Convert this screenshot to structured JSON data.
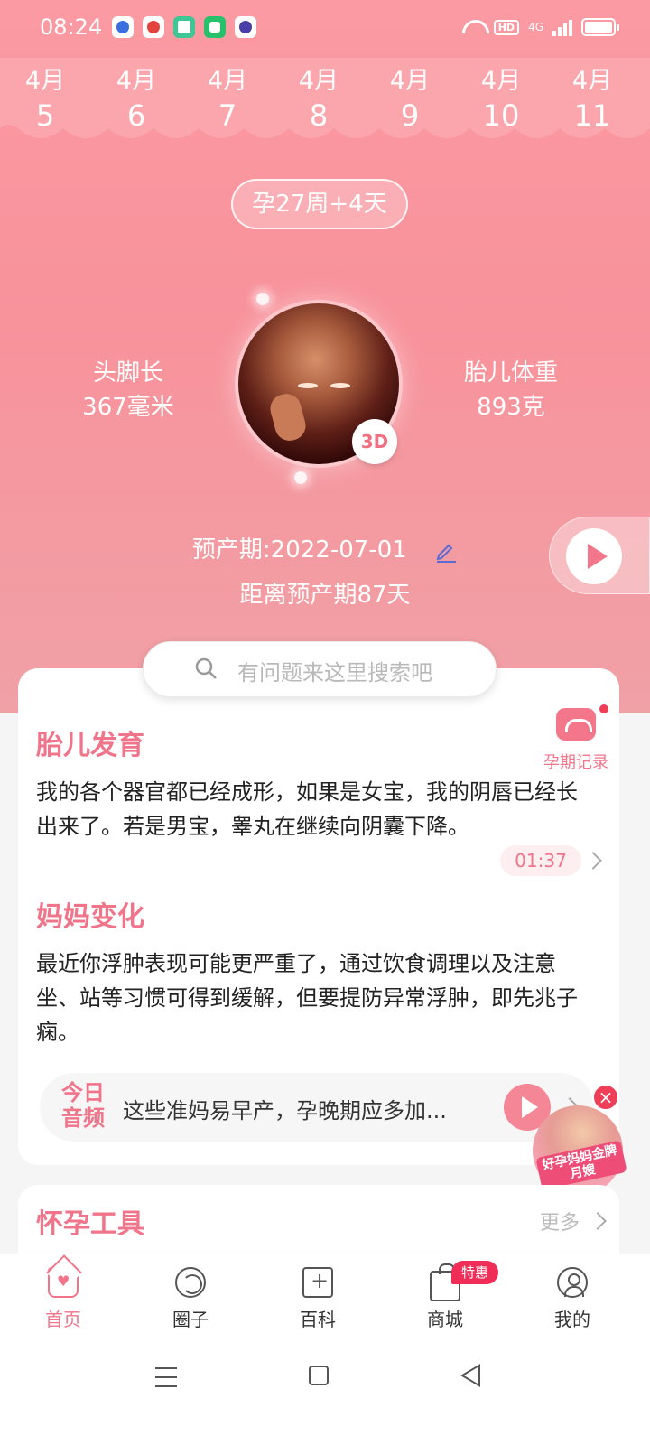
{
  "status_bar": {
    "time": "08:24",
    "apps": [
      "baidu-icon",
      "map-icon",
      "reader-icon",
      "app-icon",
      "browser-icon"
    ],
    "network": "4G",
    "hd": "HD"
  },
  "dates": [
    {
      "month": "4月",
      "day": "5",
      "selected": true
    },
    {
      "month": "4月",
      "day": "6"
    },
    {
      "month": "4月",
      "day": "7"
    },
    {
      "month": "4月",
      "day": "8"
    },
    {
      "month": "4月",
      "day": "9"
    },
    {
      "month": "4月",
      "day": "10"
    },
    {
      "month": "4月",
      "day": "11"
    }
  ],
  "pregnancy": {
    "week_label": "孕27周+4天",
    "length_label": "头脚长",
    "length_value": "367毫米",
    "weight_label": "胎儿体重",
    "weight_value": "893克",
    "badge_3d": "3D",
    "due_date": "预产期:2022-07-01",
    "countdown": "距离预产期87天"
  },
  "search": {
    "placeholder": "有问题来这里搜索吧"
  },
  "record": {
    "label": "孕期记录"
  },
  "sections": {
    "fetal_title": "胎儿发育",
    "fetal_text": "我的各个器官都已经成形，如果是女宝，我的阴唇已经长出来了。若是男宝，睾丸在继续向阴囊下降。",
    "fetal_duration": "01:37",
    "mom_title": "妈妈变化",
    "mom_text": "最近你浮肿表现可能更严重了，通过饮食调理以及注意坐、站等习惯可得到缓解，但要提防异常浮肿，即先兆子痫。",
    "tools_title": "怀孕工具",
    "tools_more": "更多"
  },
  "daily_audio": {
    "logo_line1": "今日",
    "logo_line2": "音频",
    "text": "这些准妈易早产，孕晚期应多加..."
  },
  "float_ad": {
    "text": "好孕妈妈金牌月嫂",
    "close": "×"
  },
  "bottom_nav": [
    {
      "label": "首页",
      "icon": "home-icon",
      "active": true
    },
    {
      "label": "圈子",
      "icon": "circle-icon"
    },
    {
      "label": "百科",
      "icon": "encyclopedia-icon"
    },
    {
      "label": "商城",
      "icon": "shop-icon"
    },
    {
      "label": "我的",
      "icon": "profile-icon"
    }
  ],
  "shop_badge": "特惠",
  "colors": {
    "accent": "#f0758a",
    "hero_top": "#fb9aa2",
    "hero_bottom": "#f0a1a6",
    "badge_red": "#ef2d56"
  }
}
